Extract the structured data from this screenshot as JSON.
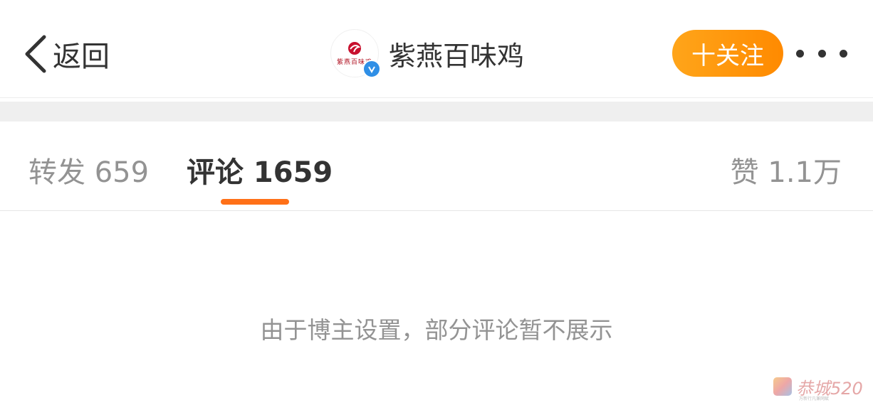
{
  "nav": {
    "back_label": "返回",
    "account_name": "紫燕百味鸡",
    "avatar_text": "紫燕百味鸡",
    "follow_label": "十关注"
  },
  "tabs": {
    "repost": "转发 659",
    "comment": "评论 1659",
    "like": "赞 1.1万"
  },
  "notice": "由于博主设置，部分评论暂不展示",
  "watermark": {
    "text": "恭城520",
    "subtext": "万新行凡兼网赋"
  },
  "colors": {
    "accent": "#ff7018",
    "follow_button": "#ff9a00",
    "verified": "#2f8fe6"
  }
}
